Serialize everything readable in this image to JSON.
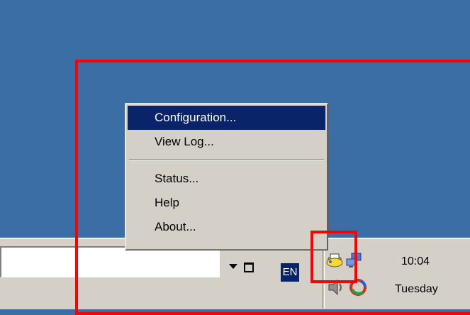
{
  "menu": {
    "items": [
      {
        "label": "Configuration...",
        "highlighted": true
      },
      {
        "label": "View Log..."
      },
      {
        "label": "Status..."
      },
      {
        "label": "Help"
      },
      {
        "label": "About..."
      }
    ]
  },
  "taskbar": {
    "language": "EN",
    "clock_time": "10:04",
    "clock_day": "Tuesday"
  },
  "tray_icons": [
    "printer-tray-icon",
    "network-computers-icon",
    "speaker-icon",
    "colorful-app-icon"
  ],
  "colors": {
    "desktop": "#3A6EA5",
    "menu_bg": "#D4D0C8",
    "highlight": "#0A246A",
    "annotation": "#FF0000"
  }
}
